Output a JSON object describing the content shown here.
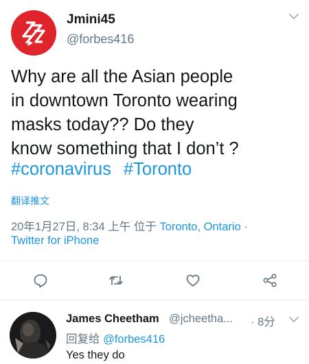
{
  "tweet": {
    "author_name": "Jmini45",
    "author_handle": "@forbes416",
    "body_lines": [
      "Why are all the Asian people",
      "in downtown Toronto wearing",
      "masks today??  Do they",
      "know something that I don’t ?"
    ],
    "hashtags": [
      "#coronavirus",
      "#Toronto"
    ],
    "translate_label": "翻译推文",
    "timestamp": "20年1月27日, 8:34 上午 位于",
    "location": "Toronto, Ontario",
    "separator": "·",
    "source": "Twitter for iPhone"
  },
  "actions": {
    "icons": [
      "reply-icon",
      "retweet-icon",
      "like-icon",
      "share-icon"
    ]
  },
  "reply": {
    "author_name": "James Cheetham",
    "author_handle": "@jcheetha...",
    "time": "· 8分",
    "replying_prefix": "回复给",
    "replying_to": "@forbes416",
    "text": "Yes they do"
  },
  "colors": {
    "text": "#14171a",
    "secondary": "#657786",
    "link": "#1b95e0",
    "avatar_red": "#e0242b"
  }
}
